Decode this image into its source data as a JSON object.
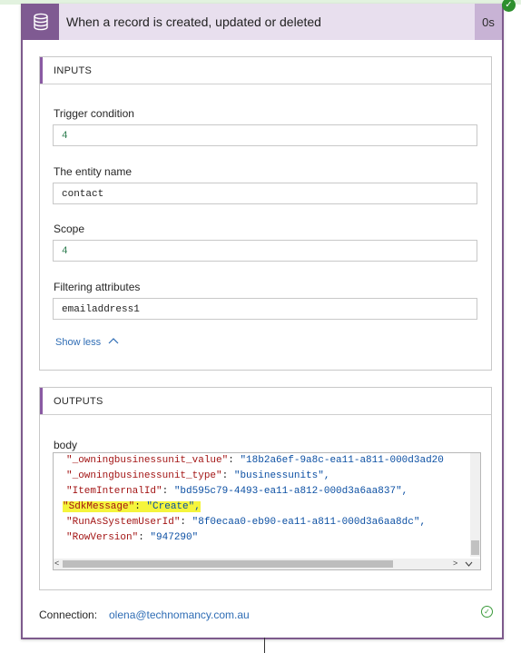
{
  "header": {
    "title": "When a record is created, updated or deleted",
    "duration": "0s",
    "icon": "database-icon"
  },
  "inputs": {
    "title": "INPUTS",
    "fields": [
      {
        "label": "Trigger condition",
        "value": "4"
      },
      {
        "label": "The entity name",
        "value": "contact"
      },
      {
        "label": "Scope",
        "value": "4"
      },
      {
        "label": "Filtering attributes",
        "value": "emailaddress1"
      }
    ],
    "show_less": "Show less"
  },
  "outputs": {
    "title": "OUTPUTS",
    "body_label": "body",
    "lines": [
      {
        "key": "\"_owningbusinessunit_value\"",
        "value": "\"18b2a6ef-9a8c-ea11-a811-000d3ad20"
      },
      {
        "key": "\"_owningbusinessunit_type\"",
        "value": "\"businessunits\","
      },
      {
        "key": "\"ItemInternalId\"",
        "value": "\"bd595c79-4493-ea11-a812-000d3a6aa837\","
      },
      {
        "key": "\"SdkMessage\"",
        "value": "\"Create\","
      },
      {
        "key": "\"RunAsSystemUserId\"",
        "value": "\"8f0ecaa0-eb90-ea11-a811-000d3a6aa8dc\","
      },
      {
        "key": "\"RowVersion\"",
        "value": "\"947290\""
      }
    ]
  },
  "connection": {
    "label": "Connection:",
    "value": "olena@technomancy.com.au"
  },
  "colors": {
    "header_bg": "#e8dfee",
    "icon_bg": "#7f5a92",
    "accent": "#8a5aa3",
    "link": "#2f6db5",
    "highlight": "#f5f53c"
  }
}
